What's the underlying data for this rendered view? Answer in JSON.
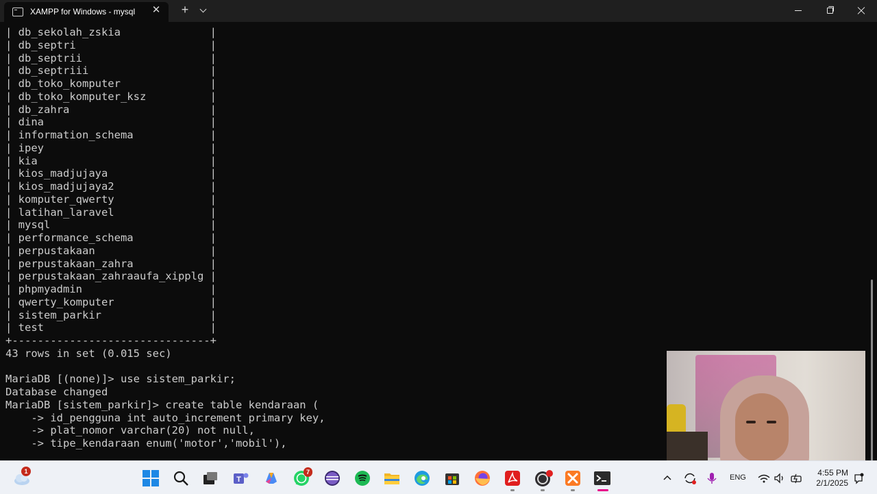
{
  "window": {
    "tab_title": "XAMPP for Windows - mysql",
    "new_tab_label": "+"
  },
  "terminal": {
    "lines": [
      "| db_sekolah_zskia              |",
      "| db_septri                     |",
      "| db_septrii                    |",
      "| db_septriii                   |",
      "| db_toko_komputer              |",
      "| db_toko_komputer_ksz          |",
      "| db_zahra                      |",
      "| dina                          |",
      "| information_schema            |",
      "| ipey                          |",
      "| kia                           |",
      "| kios_madjujaya                |",
      "| kios_madjujaya2               |",
      "| komputer_qwerty               |",
      "| latihan_laravel               |",
      "| mysql                         |",
      "| performance_schema            |",
      "| perpustakaan                  |",
      "| perpustakaan_zahra            |",
      "| perpustakaan_zahraaufa_xipplg |",
      "| phpmyadmin                    |",
      "| qwerty_komputer               |",
      "| sistem_parkir                 |",
      "| test                          |",
      "+-------------------------------+",
      "43 rows in set (0.015 sec)",
      "",
      "MariaDB [(none)]> use sistem_parkir;",
      "Database changed",
      "MariaDB [sistem_parkir]> create table kendaraan (",
      "    -> id_pengguna int auto_increment primary key,",
      "    -> plat_nomor varchar(20) not null,",
      "    -> tipe_kendaraan enum('motor','mobil'),"
    ]
  },
  "taskbar": {
    "weather_badge": "1",
    "whatsapp_badge": "7",
    "apps": [
      "weather-icon",
      "start-icon",
      "search-icon",
      "task-view-icon",
      "teams-icon",
      "copilot-icon",
      "whatsapp-icon",
      "eclipse-icon",
      "spotify-icon",
      "file-explorer-icon",
      "edge-icon",
      "store-icon",
      "firefox-icon",
      "acrobat-icon",
      "obs-icon",
      "xampp-icon",
      "terminal-icon"
    ],
    "language": "ENG",
    "time": "4:55 PM",
    "date": "2/1/2025"
  },
  "colors": {
    "terminal_bg": "#0c0c0c",
    "terminal_text": "#cccccc",
    "titlebar_bg": "#1f1f1f",
    "taskbar_bg": "#eef1f6",
    "badge_red": "#c42b1c"
  }
}
